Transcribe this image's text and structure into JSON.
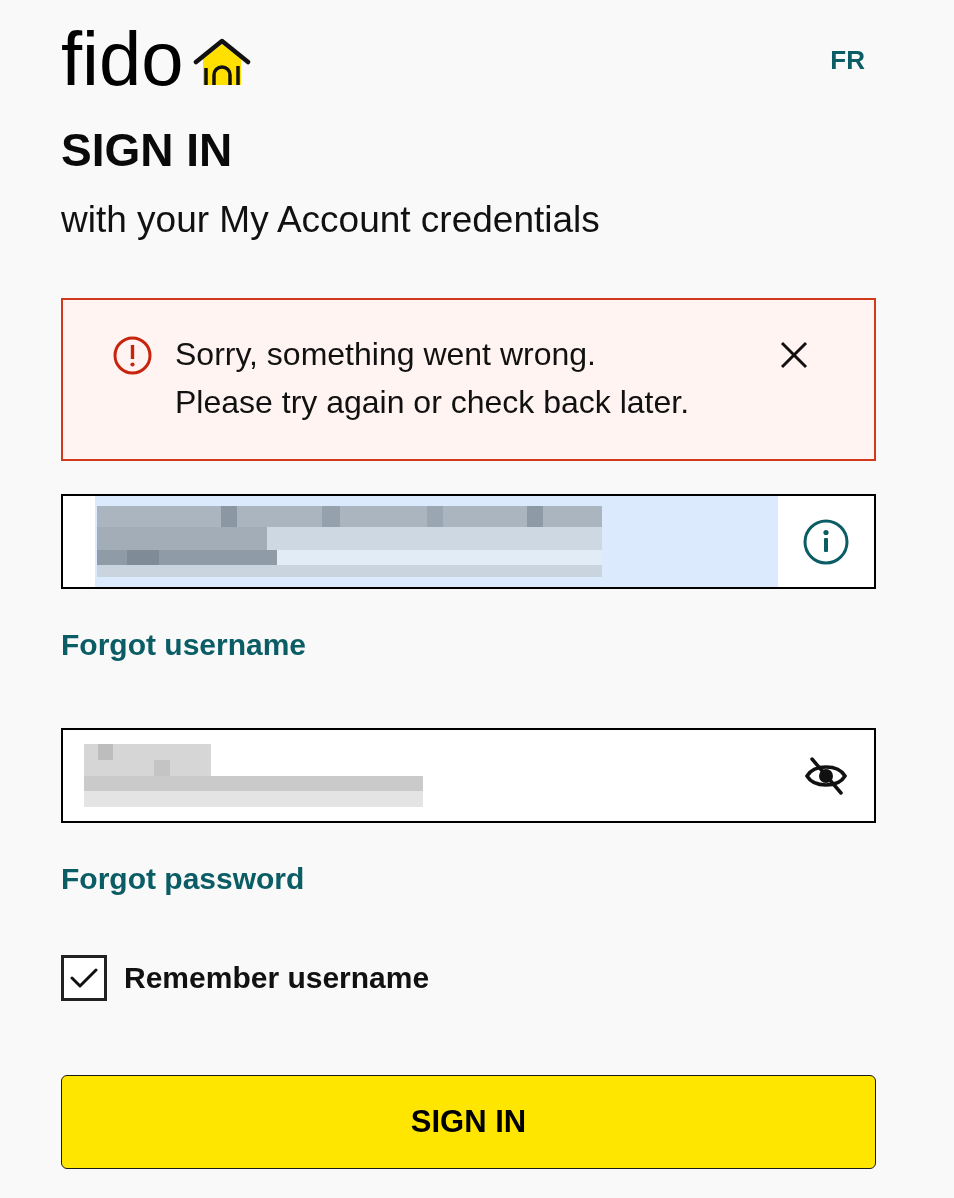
{
  "header": {
    "logo_text": "fido",
    "language_link": "FR"
  },
  "heading": {
    "title": "SIGN IN",
    "subtitle": "with your My Account credentials"
  },
  "alert": {
    "kind": "error",
    "lines": [
      "Sorry, something went wrong.",
      "Please try again or check back later."
    ]
  },
  "fields": [
    {
      "kind": "username",
      "autofilled": true,
      "redacted": true,
      "link": "Forgot username"
    },
    {
      "kind": "password",
      "autofilled": false,
      "redacted": true,
      "link": "Forgot password"
    }
  ],
  "remember": {
    "label": "Remember username",
    "checked": true
  },
  "submit": {
    "label": "SIGN IN"
  }
}
